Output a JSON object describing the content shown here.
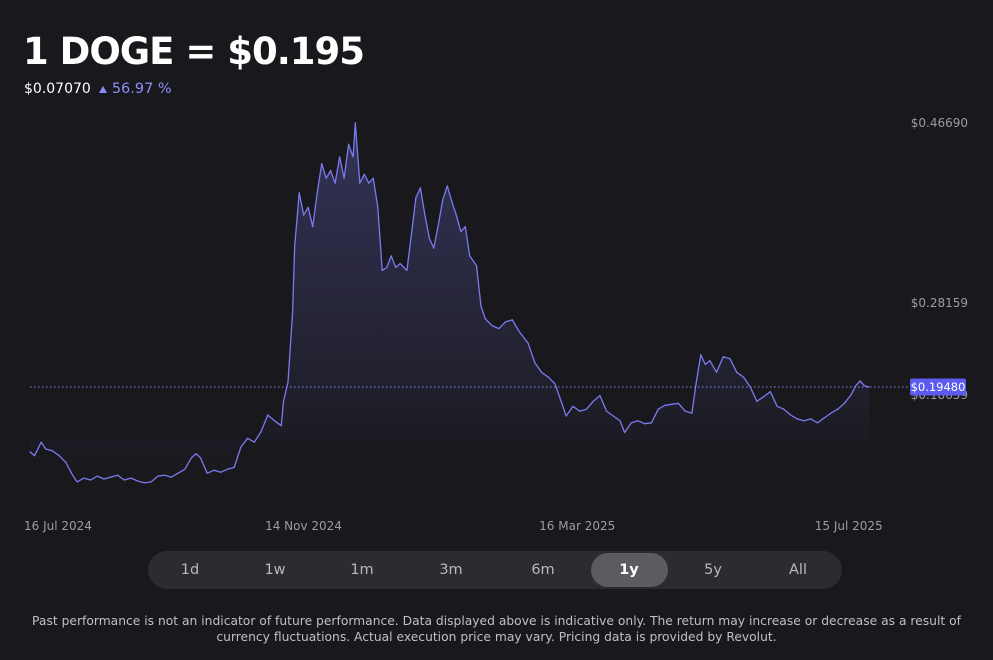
{
  "header": {
    "title": "1 DOGE = $0.195",
    "change_abs": "$0.07070",
    "change_pct": "56.97 %",
    "change_icon": "triangle-up-icon"
  },
  "colors": {
    "background": "#19181c",
    "accent": "#8d8dfb",
    "line": "#7a7af0",
    "price_tag": "#5b5bf0"
  },
  "periods": [
    {
      "label": "1d",
      "active": false
    },
    {
      "label": "1w",
      "active": false
    },
    {
      "label": "1m",
      "active": false
    },
    {
      "label": "3m",
      "active": false
    },
    {
      "label": "6m",
      "active": false
    },
    {
      "label": "1y",
      "active": true
    },
    {
      "label": "5y",
      "active": false
    },
    {
      "label": "All",
      "active": false
    }
  ],
  "disclaimer": "Past performance is not an indicator of future performance. Data displayed above is indicative only. The return may increase or decrease as a result of currency fluctuations. Actual execution price may vary. Pricing data is provided by Revolut.",
  "chart_data": {
    "type": "area",
    "title": "1 DOGE = $0.195",
    "y_ticks": [
      {
        "value": 0.4669,
        "label": "$0.46690"
      },
      {
        "value": 0.28159,
        "label": "$0.28159"
      },
      {
        "value": 0.18659,
        "label": "$0.18659"
      }
    ],
    "x_ticks": [
      {
        "date": "2024-07-16",
        "label": "16 Jul 2024"
      },
      {
        "date": "2024-11-14",
        "label": "14 Nov 2024"
      },
      {
        "date": "2025-03-16",
        "label": "16 Mar 2025"
      },
      {
        "date": "2025-07-15",
        "label": "15 Jul 2025"
      }
    ],
    "current_price": {
      "value": 0.1948,
      "label": "$0.19480"
    },
    "ylim": [
      0.065,
      0.47
    ],
    "xlim": [
      "2024-07-16",
      "2025-08-10"
    ],
    "grid": false,
    "series": [
      {
        "points": [
          [
            "2024-07-16",
            0.128
          ],
          [
            "2024-07-18",
            0.124
          ],
          [
            "2024-07-21",
            0.138
          ],
          [
            "2024-07-23",
            0.131
          ],
          [
            "2024-07-26",
            0.129
          ],
          [
            "2024-07-29",
            0.124
          ],
          [
            "2024-08-01",
            0.117
          ],
          [
            "2024-08-04",
            0.104
          ],
          [
            "2024-08-06",
            0.097
          ],
          [
            "2024-08-09",
            0.101
          ],
          [
            "2024-08-12",
            0.099
          ],
          [
            "2024-08-15",
            0.103
          ],
          [
            "2024-08-18",
            0.1
          ],
          [
            "2024-08-21",
            0.102
          ],
          [
            "2024-08-24",
            0.104
          ],
          [
            "2024-08-27",
            0.099
          ],
          [
            "2024-08-30",
            0.101
          ],
          [
            "2024-09-02",
            0.098
          ],
          [
            "2024-09-05",
            0.096
          ],
          [
            "2024-09-08",
            0.097
          ],
          [
            "2024-09-11",
            0.103
          ],
          [
            "2024-09-14",
            0.104
          ],
          [
            "2024-09-17",
            0.102
          ],
          [
            "2024-09-20",
            0.106
          ],
          [
            "2024-09-23",
            0.11
          ],
          [
            "2024-09-26",
            0.122
          ],
          [
            "2024-09-28",
            0.126
          ],
          [
            "2024-09-30",
            0.122
          ],
          [
            "2024-10-03",
            0.106
          ],
          [
            "2024-10-06",
            0.109
          ],
          [
            "2024-10-09",
            0.107
          ],
          [
            "2024-10-12",
            0.11
          ],
          [
            "2024-10-15",
            0.112
          ],
          [
            "2024-10-18",
            0.133
          ],
          [
            "2024-10-21",
            0.142
          ],
          [
            "2024-10-24",
            0.138
          ],
          [
            "2024-10-27",
            0.149
          ],
          [
            "2024-10-30",
            0.166
          ],
          [
            "2024-11-02",
            0.16
          ],
          [
            "2024-11-05",
            0.155
          ],
          [
            "2024-11-06",
            0.18
          ],
          [
            "2024-11-08",
            0.2
          ],
          [
            "2024-11-10",
            0.27
          ],
          [
            "2024-11-11",
            0.34
          ],
          [
            "2024-11-13",
            0.395
          ],
          [
            "2024-11-15",
            0.372
          ],
          [
            "2024-11-17",
            0.38
          ],
          [
            "2024-11-19",
            0.36
          ],
          [
            "2024-11-21",
            0.395
          ],
          [
            "2024-11-23",
            0.425
          ],
          [
            "2024-11-25",
            0.41
          ],
          [
            "2024-11-27",
            0.418
          ],
          [
            "2024-11-29",
            0.405
          ],
          [
            "2024-12-01",
            0.432
          ],
          [
            "2024-12-03",
            0.41
          ],
          [
            "2024-12-05",
            0.445
          ],
          [
            "2024-12-07",
            0.432
          ],
          [
            "2024-12-08",
            0.467
          ],
          [
            "2024-12-10",
            0.405
          ],
          [
            "2024-12-12",
            0.414
          ],
          [
            "2024-12-14",
            0.405
          ],
          [
            "2024-12-16",
            0.41
          ],
          [
            "2024-12-18",
            0.38
          ],
          [
            "2024-12-20",
            0.315
          ],
          [
            "2024-12-22",
            0.318
          ],
          [
            "2024-12-24",
            0.33
          ],
          [
            "2024-12-26",
            0.318
          ],
          [
            "2024-12-28",
            0.322
          ],
          [
            "2024-12-31",
            0.315
          ],
          [
            "2025-01-02",
            0.352
          ],
          [
            "2025-01-04",
            0.39
          ],
          [
            "2025-01-06",
            0.4
          ],
          [
            "2025-01-08",
            0.372
          ],
          [
            "2025-01-10",
            0.348
          ],
          [
            "2025-01-12",
            0.338
          ],
          [
            "2025-01-14",
            0.362
          ],
          [
            "2025-01-16",
            0.388
          ],
          [
            "2025-01-18",
            0.402
          ],
          [
            "2025-01-20",
            0.386
          ],
          [
            "2025-01-22",
            0.372
          ],
          [
            "2025-01-24",
            0.355
          ],
          [
            "2025-01-26",
            0.36
          ],
          [
            "2025-01-28",
            0.33
          ],
          [
            "2025-01-31",
            0.32
          ],
          [
            "2025-02-02",
            0.278
          ],
          [
            "2025-02-04",
            0.265
          ],
          [
            "2025-02-07",
            0.258
          ],
          [
            "2025-02-10",
            0.255
          ],
          [
            "2025-02-13",
            0.262
          ],
          [
            "2025-02-16",
            0.264
          ],
          [
            "2025-02-19",
            0.252
          ],
          [
            "2025-02-23",
            0.24
          ],
          [
            "2025-02-26",
            0.22
          ],
          [
            "2025-03-01",
            0.21
          ],
          [
            "2025-03-04",
            0.205
          ],
          [
            "2025-03-07",
            0.198
          ],
          [
            "2025-03-09",
            0.185
          ],
          [
            "2025-03-12",
            0.165
          ],
          [
            "2025-03-15",
            0.175
          ],
          [
            "2025-03-18",
            0.17
          ],
          [
            "2025-03-21",
            0.172
          ],
          [
            "2025-03-24",
            0.18
          ],
          [
            "2025-03-27",
            0.186
          ],
          [
            "2025-03-30",
            0.17
          ],
          [
            "2025-04-02",
            0.165
          ],
          [
            "2025-04-05",
            0.16
          ],
          [
            "2025-04-07",
            0.148
          ],
          [
            "2025-04-10",
            0.158
          ],
          [
            "2025-04-13",
            0.16
          ],
          [
            "2025-04-16",
            0.157
          ],
          [
            "2025-04-19",
            0.158
          ],
          [
            "2025-04-22",
            0.172
          ],
          [
            "2025-04-25",
            0.176
          ],
          [
            "2025-04-28",
            0.177
          ],
          [
            "2025-05-01",
            0.178
          ],
          [
            "2025-05-04",
            0.17
          ],
          [
            "2025-05-07",
            0.168
          ],
          [
            "2025-05-09",
            0.2
          ],
          [
            "2025-05-11",
            0.228
          ],
          [
            "2025-05-13",
            0.218
          ],
          [
            "2025-05-15",
            0.222
          ],
          [
            "2025-05-18",
            0.21
          ],
          [
            "2025-05-21",
            0.226
          ],
          [
            "2025-05-24",
            0.224
          ],
          [
            "2025-05-27",
            0.21
          ],
          [
            "2025-05-30",
            0.205
          ],
          [
            "2025-06-02",
            0.195
          ],
          [
            "2025-06-05",
            0.18
          ],
          [
            "2025-06-08",
            0.185
          ],
          [
            "2025-06-11",
            0.19
          ],
          [
            "2025-06-14",
            0.175
          ],
          [
            "2025-06-17",
            0.172
          ],
          [
            "2025-06-20",
            0.166
          ],
          [
            "2025-06-23",
            0.162
          ],
          [
            "2025-06-26",
            0.16
          ],
          [
            "2025-06-29",
            0.162
          ],
          [
            "2025-07-02",
            0.158
          ],
          [
            "2025-07-05",
            0.163
          ],
          [
            "2025-07-08",
            0.168
          ],
          [
            "2025-07-11",
            0.172
          ],
          [
            "2025-07-14",
            0.178
          ],
          [
            "2025-07-17",
            0.187
          ],
          [
            "2025-07-19",
            0.196
          ],
          [
            "2025-07-21",
            0.201
          ],
          [
            "2025-07-23",
            0.196
          ],
          [
            "2025-07-25",
            0.1948
          ]
        ]
      }
    ]
  }
}
